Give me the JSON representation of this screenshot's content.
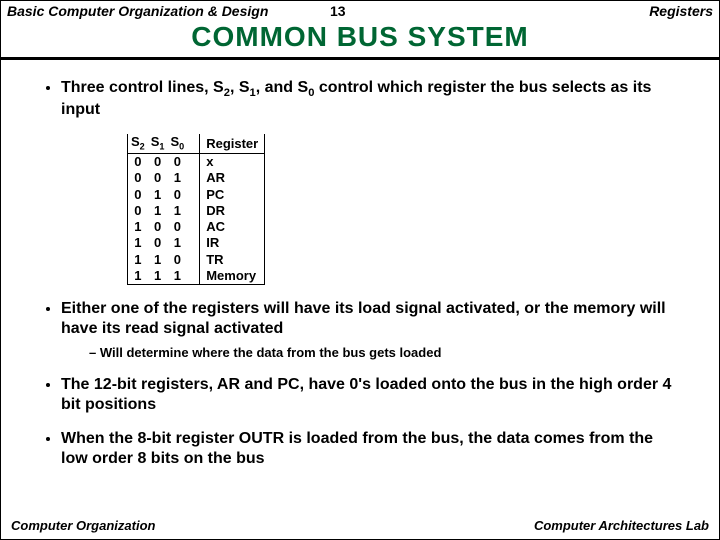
{
  "header": {
    "left": "Basic Computer Organization & Design",
    "center": "13",
    "right": "Registers"
  },
  "title": "COMMON  BUS  SYSTEM",
  "bullet1_pre": "Three control lines, S",
  "bullet1_s2": "2",
  "bullet1_mid1": ", S",
  "bullet1_s1": "1",
  "bullet1_mid2": ", and S",
  "bullet1_s0": "0",
  "bullet1_post": " control which register the bus selects as its input",
  "table": {
    "h_s2a": "S",
    "h_s2b": "2",
    "h_s1a": "S",
    "h_s1b": "1",
    "h_s0a": "S",
    "h_s0b": "0",
    "h_reg": "Register",
    "rows": [
      {
        "b": [
          "0",
          "0",
          "0"
        ],
        "r": "x"
      },
      {
        "b": [
          "0",
          "0",
          "1"
        ],
        "r": "AR"
      },
      {
        "b": [
          "0",
          "1",
          "0"
        ],
        "r": "PC"
      },
      {
        "b": [
          "0",
          "1",
          "1"
        ],
        "r": "DR"
      },
      {
        "b": [
          "1",
          "0",
          "0"
        ],
        "r": "AC"
      },
      {
        "b": [
          "1",
          "0",
          "1"
        ],
        "r": "IR"
      },
      {
        "b": [
          "1",
          "1",
          "0"
        ],
        "r": "TR"
      },
      {
        "b": [
          "1",
          "1",
          "1"
        ],
        "r": "Memory"
      }
    ]
  },
  "bullet2": "Either one of the registers will have its load signal activated, or the memory will have its read signal activated",
  "bullet2_sub": "Will determine where the data from the bus gets loaded",
  "bullet3": "The 12-bit registers, AR and PC, have 0's loaded onto the bus in the high order 4 bit positions",
  "bullet4": "When the 8-bit register OUTR is loaded from the bus, the data comes from the low order 8 bits on the bus",
  "footer": {
    "left": "Computer Organization",
    "right": "Computer Architectures Lab"
  }
}
